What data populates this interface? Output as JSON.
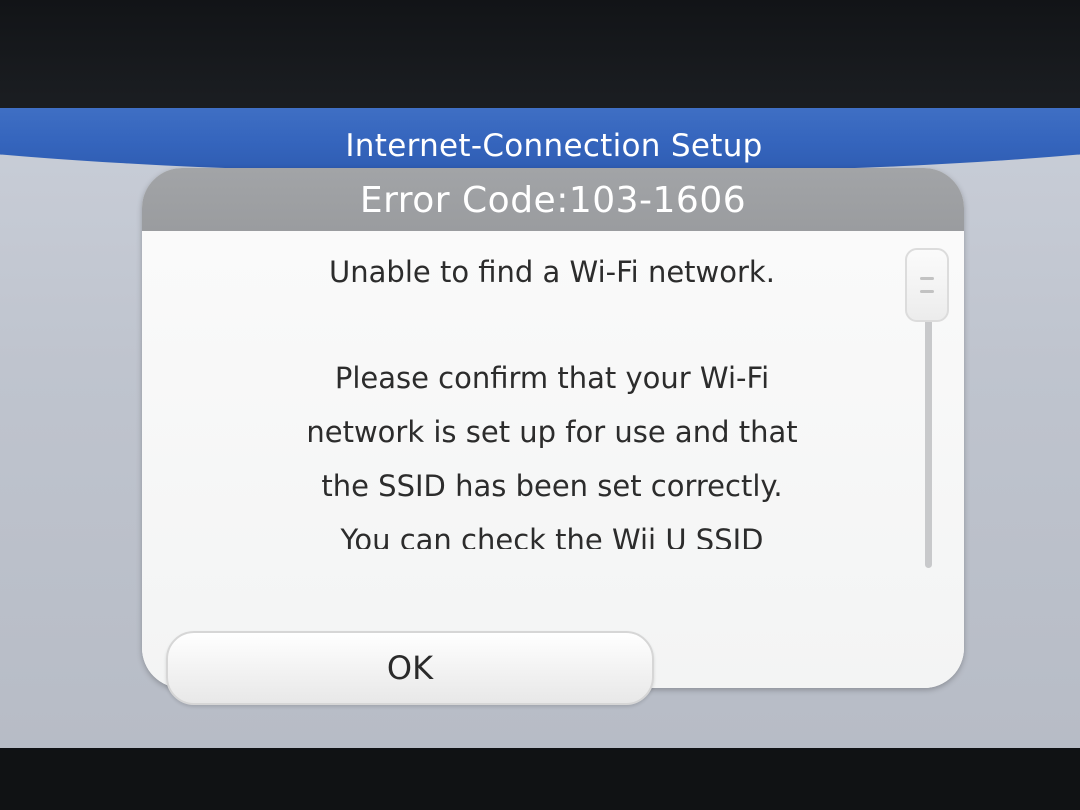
{
  "window": {
    "title": "Internet-Connection Setup"
  },
  "dialog": {
    "error_code": "Error Code:103-1606",
    "message_lines": {
      "line1": "Unable to find a Wi-Fi network.",
      "line2": "Please confirm that your Wi-Fi",
      "line3": "network is set up for use and that",
      "line4": "the SSID has been set correctly.",
      "line5": "You can check the Wii U SSID"
    },
    "ok_label": "OK"
  },
  "colors": {
    "title_bar_blue": "#3565bd",
    "header_gray": "#9a9c9f",
    "dialog_background": "#f5f5f5",
    "screen_background": "#bfc4ce"
  }
}
